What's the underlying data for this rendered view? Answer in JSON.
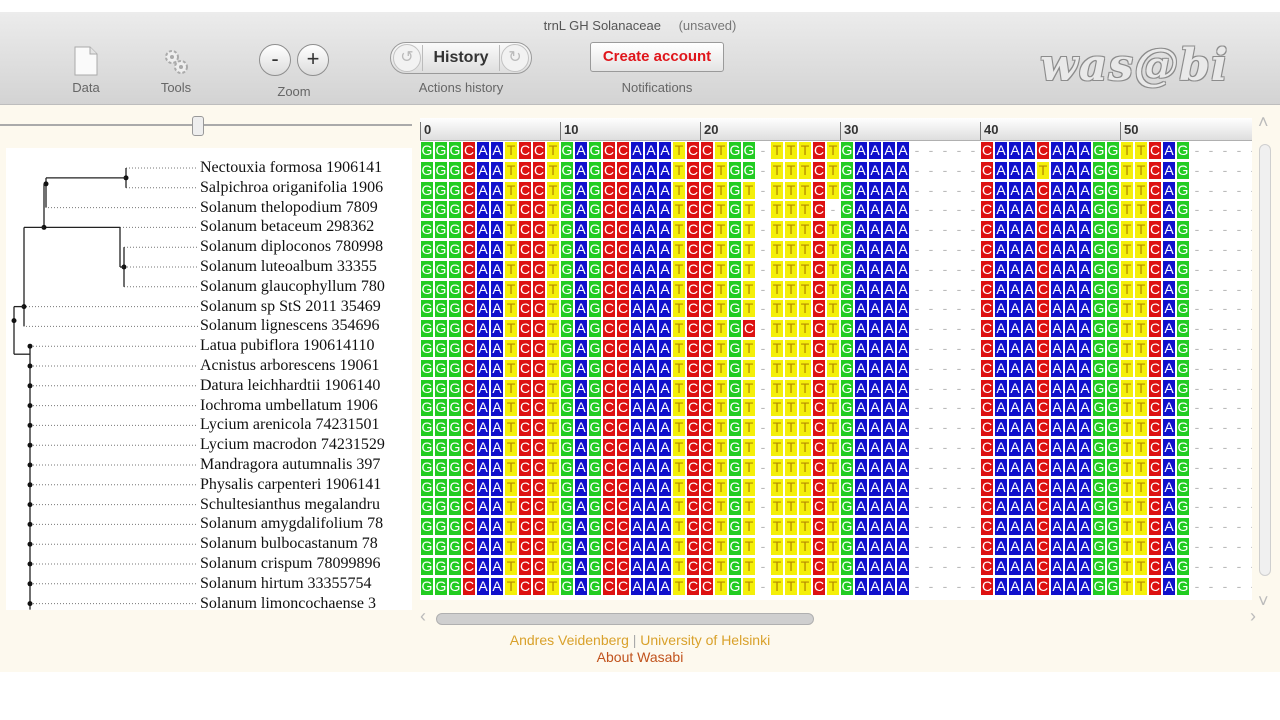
{
  "toolbar": {
    "title": "trnL GH Solanaceae",
    "status": "(unsaved)",
    "data_label": "Data",
    "tools_label": "Tools",
    "zoom_label": "Zoom",
    "zoom_out": "-",
    "zoom_in": "+",
    "history_label": "History",
    "history_caption": "Actions history",
    "create_account": "Create account",
    "notifications": "Notifications",
    "logo": "was@bi"
  },
  "ruler": {
    "ticks": [
      "0",
      "10",
      "20",
      "30",
      "40",
      "50"
    ]
  },
  "tree": {
    "leaves": [
      "Nectouxia formosa 1906141",
      "Salpichroa origanifolia 1906",
      "Solanum thelopodium 7809",
      "Solanum betaceum 298362",
      "Solanum diploconos 780998",
      "Solanum luteoalbum 33355",
      "Solanum glaucophyllum 780",
      "Solanum sp StS 2011 35469",
      "Solanum lignescens 354696",
      "Latua pubiflora 190614110",
      "Acnistus arborescens 19061",
      "Datura leichhardtii 1906140",
      "Iochroma umbellatum 1906",
      "Lycium arenicola 74231501",
      "Lycium macrodon 74231529",
      "Mandragora autumnalis 397",
      "Physalis carpenteri 1906141",
      "Schultesianthus megalandru",
      "Solanum amygdalifolium 78",
      "Solanum bulbocastanum 78",
      "Solanum crispum 78099896",
      "Solanum hirtum 33355754",
      "Solanum limoncochaense 3"
    ]
  },
  "alignment": {
    "sequences": [
      "GGGCAATCCTGAGCCAAATCCTGG-TTTCTGAAAA-----CAAACAAAGGTTCAG-----",
      "GGGCAATCCTGAGCCAAATCCTGG-TTTCTGAAAA-----CAAATAAAGGTTCAG-----",
      "GGGCAATCCTGAGCCAAATCCTGT-TTTCTGAAAA-----CAAACAAAGGTTCAG-----",
      "GGGCAATCCTGAGCCAAATCCTGT-TTTC-GAAAA-----CAAACAAAGGTTCAG-----",
      "GGGCAATCCTGAGCCAAATCCTGT-TTTCTGAAAA-----CAAACAAAGGTTCAG-----",
      "GGGCAATCCTGAGCCAAATCCTGT-TTTCTGAAAA-----CAAACAAAGGTTCAG-----",
      "GGGCAATCCTGAGCCAAATCCTGT-TTTCTGAAAA-----CAAACAAAGGTTCAG-----",
      "GGGCAATCCTGAGCCAAATCCTGT-TTTCTGAAAA-----CAAACAAAGGTTCAG-----",
      "GGGCAATCCTGAGCCAAATCCTGT-TTTCTGAAAA-----CAAACAAAGGTTCAG-----",
      "GGGCAATCCTGAGCCAAATCCTGC-TTTCTGAAAA-----CAAACAAAGGTTCAG-----",
      "GGGCAATCCTGAGCCAAATCCTGT-TTTCTGAAAA-----CAAACAAAGGTTCAG-----",
      "GGGCAATCCTGAGCCAAATCCTGT-TTTCTGAAAA-----CAAACAAAGGTTCAG-----",
      "GGGCAATCCTGAGCCAAATCCTGT-TTTCTGAAAA-----CAAACAAAGGTTCAG-----",
      "GGGCAATCCTGAGCCAAATCCTGT-TTTCTGAAAA-----CAAACAAAGGTTCAG-----",
      "GGGCAATCCTGAGCCAAATCCTGT-TTTCTGAAAA-----CAAACAAAGGTTCAG-----",
      "GGGCAATCCTGAGCCAAATCCTGT-TTTCTGAAAA-----CAAACAAAGGTTCAG-----",
      "GGGCAATCCTGAGCCAAATCCTGT-TTTCTGAAAA-----CAAACAAAGGTTCAG-----",
      "GGGCAATCCTGAGCCAAATCCTGT-TTTCTGAAAA-----CAAACAAAGGTTCAG-----",
      "GGGCAATCCTGAGCCAAATCCTGT-TTTCTGAAAA-----CAAACAAAGGTTCAG-----",
      "GGGCAATCCTGAGCCAAATCCTGT-TTTCTGAAAA-----CAAACAAAGGTTCAG-----",
      "GGGCAATCCTGAGCCAAATCCTGT-TTTCTGAAAA-----CAAACAAAGGTTCAG-----",
      "GGGCAATCCTGAGCCAAATCCTGT-TTTCTGAAAA-----CAAACAAAGGTTCAG-----",
      "GGGCAATCCTGAGCCAAATCCTGT-TTTCTGAAAA-----CAAACAAAGGTTCAG-----"
    ],
    "colors": {
      "G": "#22cc22",
      "A": "#1010cc",
      "C": "#dd1111",
      "T": "#f4ef0a"
    }
  },
  "footer": {
    "author": "Andres Veidenberg",
    "separator": "|",
    "institution": "University of Helsinki",
    "about": "About Wasabi"
  }
}
